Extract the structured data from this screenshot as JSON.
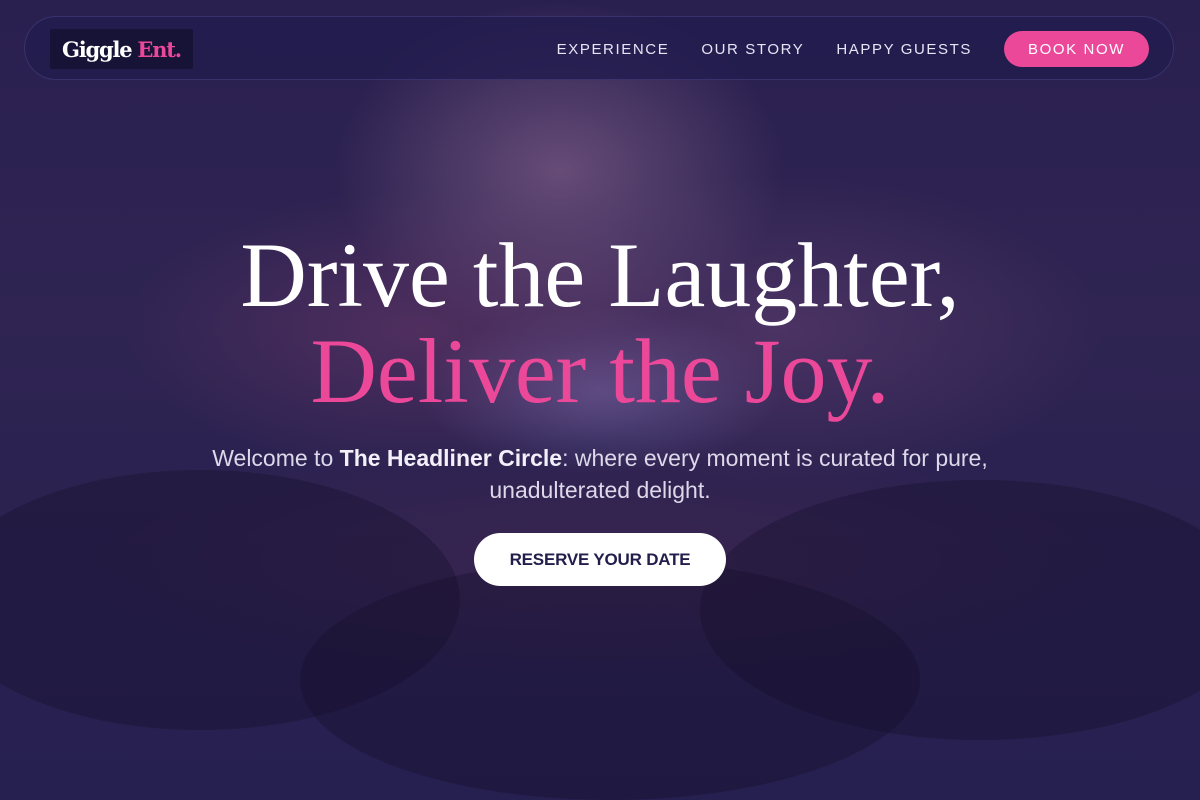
{
  "brand": {
    "name_part1": "Giggle",
    "name_part2": "Ent."
  },
  "nav": {
    "links": [
      "EXPERIENCE",
      "OUR STORY",
      "HAPPY GUESTS"
    ],
    "cta_label": "BOOK NOW"
  },
  "hero": {
    "headline_line1": "Drive the Laughter,",
    "headline_line2": "Deliver the Joy.",
    "subtext_prefix": "Welcome to ",
    "subtext_highlight": "The Headliner Circle",
    "subtext_suffix": ": where every moment is curated for pure, unadulterated delight.",
    "cta_label": "RESERVE YOUR DATE"
  },
  "colors": {
    "accent": "#ec4899",
    "background": "#27204f",
    "text_primary": "#ffffff"
  }
}
